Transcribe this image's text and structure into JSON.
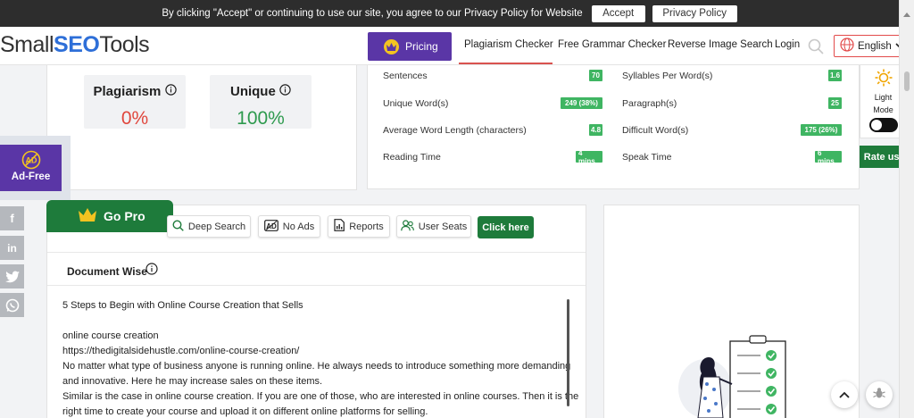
{
  "cookie": {
    "message": "By clicking \"Accept\" or continuing to use our site, you agree to our Privacy Policy for Website",
    "accept_label": "Accept",
    "privacy_label": "Privacy Policy"
  },
  "header": {
    "logo_small": "Small",
    "logo_seo": "SEO",
    "logo_tools": "Tools",
    "pricing_label": "Pricing",
    "nav": [
      "Plagiarism Checker",
      "Free Grammar Checker",
      "Reverse Image Search",
      "Login"
    ],
    "language": "English"
  },
  "results": {
    "plagiarism_title": "Plagiarism",
    "plagiarism_value": "0%",
    "unique_title": "Unique",
    "unique_value": "100%"
  },
  "stats": {
    "left": [
      {
        "label": "Sentences",
        "value": "70"
      },
      {
        "label": "Unique Word(s)",
        "value": "249 (38%)"
      },
      {
        "label": "Average Word Length (characters)",
        "value": "4.8"
      },
      {
        "label": "Reading Time",
        "value": "4 mins"
      }
    ],
    "right": [
      {
        "label": "Syllables Per Word(s)",
        "value": "1.6"
      },
      {
        "label": "Paragraph(s)",
        "value": "25"
      },
      {
        "label": "Difficult Word(s)",
        "value": "175 (26%)"
      },
      {
        "label": "Speak Time",
        "value": "6 mins"
      }
    ]
  },
  "side": {
    "light_label_1": "Light",
    "light_label_2": "Mode",
    "rate_label": "Rate us!",
    "adfree_label": "Ad-Free",
    "adfree_icon_text": "AD"
  },
  "pro": {
    "gopro_label": "Go Pro",
    "chips": [
      "Deep Search",
      "No Ads",
      "Reports",
      "User Seats"
    ],
    "noads_icon_text": "AD",
    "click_here_label": "Click here"
  },
  "document": {
    "heading": "Document Wise",
    "lines": [
      "5 Steps to Begin with Online Course Creation that Sells",
      "",
      "online course creation",
      "https://thedigitalsidehustle.com/online-course-creation/",
      "No matter what type of business anyone is running online. He always needs to introduce something more demanding",
      "and innovative. Here he may increase sales on these items.",
      "Similar is the case in online course creation. If you are one of those, who are interested in online courses. Then it is the",
      "right time to create your course and upload it on different online platforms for selling."
    ]
  },
  "colors": {
    "accent_purple": "#5a36a6",
    "green": "#1e7b3b",
    "badge_green": "#3fb562",
    "plagiarism_red": "#e0473d",
    "unique_green": "#2e9a4e"
  }
}
